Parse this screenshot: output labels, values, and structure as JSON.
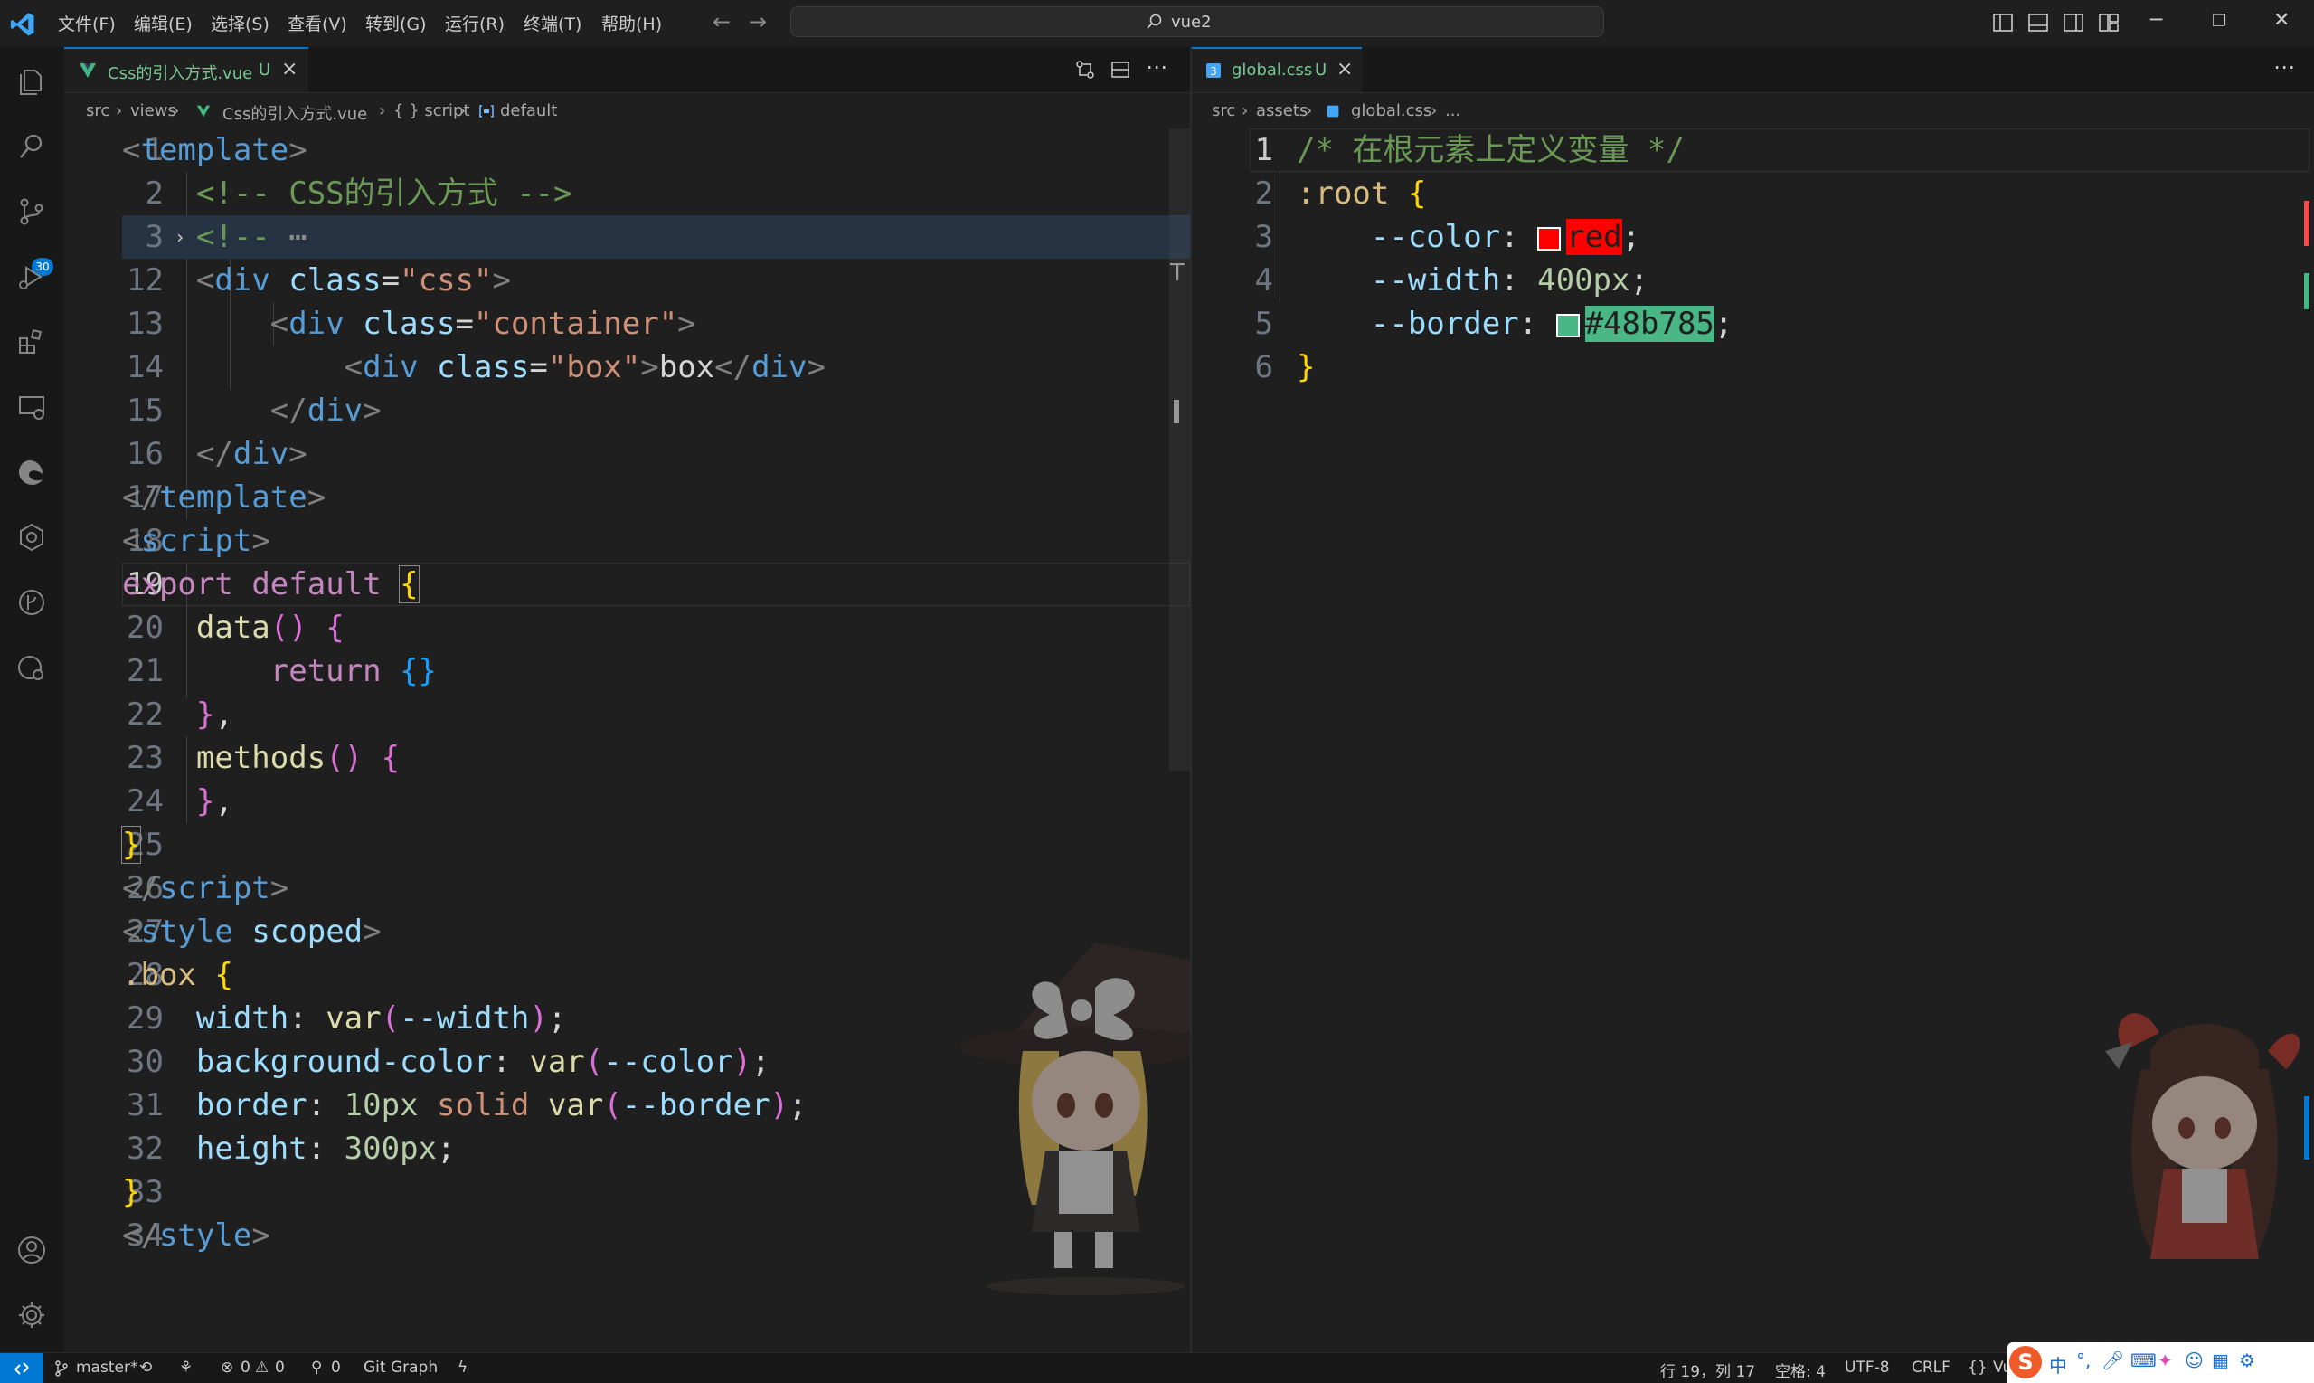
{
  "titlebar": {
    "menu": [
      "文件(F)",
      "编辑(E)",
      "选择(S)",
      "查看(V)",
      "转到(G)",
      "运行(R)",
      "终端(T)",
      "帮助(H)"
    ],
    "search_text": "vue2"
  },
  "activitybar": {
    "scm_badge": "30"
  },
  "left_editor": {
    "tab_label": "Css的引入方式.vue",
    "tab_status": "U",
    "breadcrumb": [
      "src",
      "views",
      "Css的引入方式.vue",
      "{ } script",
      "default"
    ],
    "lines": [
      {
        "num": "1"
      },
      {
        "num": "2"
      },
      {
        "num": "3"
      },
      {
        "num": "12"
      },
      {
        "num": "13"
      },
      {
        "num": "14"
      },
      {
        "num": "15"
      },
      {
        "num": "16"
      },
      {
        "num": "17"
      },
      {
        "num": "18"
      },
      {
        "num": "19"
      },
      {
        "num": "20"
      },
      {
        "num": "21"
      },
      {
        "num": "22"
      },
      {
        "num": "23"
      },
      {
        "num": "24"
      },
      {
        "num": "25"
      },
      {
        "num": "26"
      },
      {
        "num": "27"
      },
      {
        "num": "28"
      },
      {
        "num": "29"
      },
      {
        "num": "30"
      },
      {
        "num": "31"
      },
      {
        "num": "32"
      },
      {
        "num": "33"
      },
      {
        "num": "34"
      }
    ]
  },
  "right_editor": {
    "tab_label": "global.css",
    "tab_status": "U",
    "breadcrumb": [
      "src",
      "assets",
      "global.css",
      "..."
    ],
    "lines": [
      {
        "num": "1"
      },
      {
        "num": "2"
      },
      {
        "num": "3"
      },
      {
        "num": "4"
      },
      {
        "num": "5"
      },
      {
        "num": "6"
      }
    ],
    "swatches": {
      "red": "#ff0000",
      "border": "#48b785"
    }
  },
  "statusbar": {
    "branch": "master*",
    "errors": "0",
    "warnings": "0",
    "ports": "0",
    "git_graph": "Git Graph",
    "position": "行 19，列 17",
    "indent": "空格: 4",
    "encoding": "UTF-8",
    "eol": "CRLF",
    "lang": "Vu"
  },
  "colors": {
    "accent": "#0078d4",
    "untracked": "#73c991"
  }
}
